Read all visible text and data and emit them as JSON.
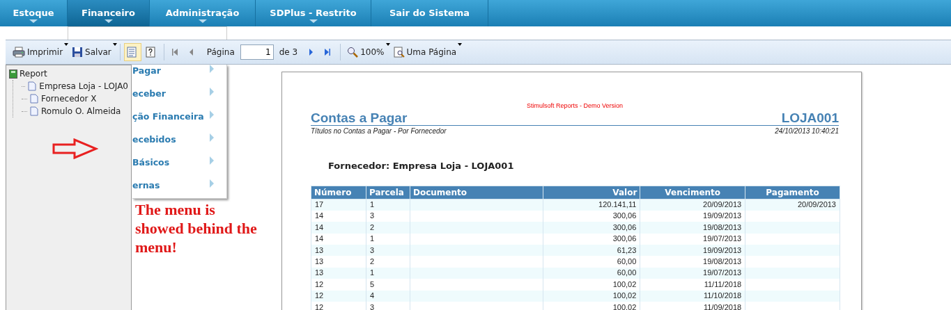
{
  "nav": {
    "items": [
      {
        "label": "Estoque",
        "has_menu": true,
        "selected": false
      },
      {
        "label": "Financeiro",
        "has_menu": true,
        "selected": true
      },
      {
        "label": "Administração",
        "has_menu": true,
        "selected": false
      },
      {
        "label": "SDPlus - Restrito",
        "has_menu": true,
        "selected": false
      },
      {
        "label": "Sair do Sistema",
        "has_menu": false,
        "selected": false
      }
    ]
  },
  "dropdown": {
    "items": [
      {
        "label": "Pagar"
      },
      {
        "label": "eceber"
      },
      {
        "label": "ção Financeira"
      },
      {
        "label": "ecebidos"
      },
      {
        "label": "Básicos"
      },
      {
        "label": "ernas"
      }
    ]
  },
  "toolbar": {
    "items": [
      {
        "kind": "print",
        "label": "Imprimir"
      },
      {
        "kind": "save",
        "label": "Salvar"
      },
      {
        "kind": "sep"
      },
      {
        "kind": "tree",
        "selected": true
      },
      {
        "kind": "help",
        "selected": false
      },
      {
        "kind": "sep"
      },
      {
        "kind": "first"
      },
      {
        "kind": "prev"
      },
      {
        "kind": "page",
        "label": "Página",
        "value": "1",
        "total": "de 3"
      },
      {
        "kind": "next"
      },
      {
        "kind": "last"
      },
      {
        "kind": "sep"
      },
      {
        "kind": "zoom",
        "label": "100%"
      },
      {
        "kind": "view",
        "label": "Uma Página"
      }
    ]
  },
  "tree": {
    "label": "Report",
    "children": [
      {
        "label": "Empresa Loja - LOJA0"
      },
      {
        "label": "Fornecedor X"
      },
      {
        "label": "Romulo O. Almeida"
      }
    ]
  },
  "annotation": {
    "text": "The menu is showed behind the menu!"
  },
  "report": {
    "demo_notice": "Stimulsoft Reports - Demo Version",
    "title": "Contas a Pagar",
    "store": "LOJA001",
    "subtitle": "Títulos no Contas a Pagar - Por Fornecedor",
    "timestamp": "24/10/2013 10:40:21",
    "group": "Fornecedor: Empresa Loja - LOJA001",
    "table": {
      "columns": [
        "Número",
        "Parcela",
        "Documento",
        "Valor",
        "Vencimento",
        "Pagamento"
      ],
      "rows": [
        [
          "17",
          "1",
          "",
          "120.141,11",
          "20/09/2013",
          "20/09/2013"
        ],
        [
          "14",
          "3",
          "",
          "300,06",
          "19/09/2013",
          ""
        ],
        [
          "14",
          "2",
          "",
          "300,06",
          "19/08/2013",
          ""
        ],
        [
          "14",
          "1",
          "",
          "300,06",
          "19/07/2013",
          ""
        ],
        [
          "13",
          "3",
          "",
          "61,23",
          "19/09/2013",
          ""
        ],
        [
          "13",
          "2",
          "",
          "60,00",
          "19/08/2013",
          ""
        ],
        [
          "13",
          "1",
          "",
          "60,00",
          "19/07/2013",
          ""
        ],
        [
          "12",
          "5",
          "",
          "100,02",
          "11/11/2018",
          ""
        ],
        [
          "12",
          "4",
          "",
          "100,02",
          "11/10/2018",
          ""
        ],
        [
          "12",
          "3",
          "",
          "100,02",
          "11/09/2018",
          ""
        ]
      ]
    }
  }
}
